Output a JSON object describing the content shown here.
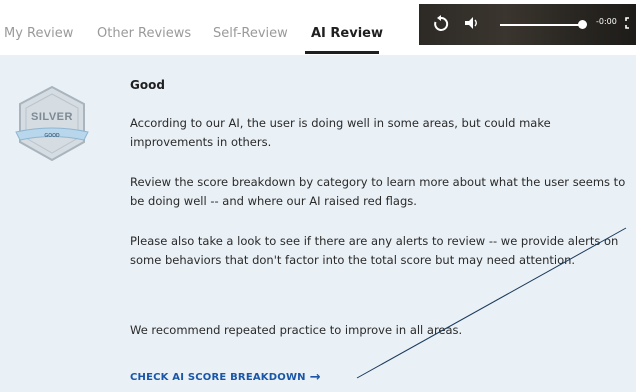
{
  "tabs": [
    {
      "label": "My Review",
      "active": false
    },
    {
      "label": "Other Reviews",
      "active": false
    },
    {
      "label": "Self-Review",
      "active": false
    },
    {
      "label": "AI Review",
      "active": true
    }
  ],
  "player": {
    "time": "-0:00",
    "replay_icon": "replay-icon",
    "volume_icon": "volume-icon",
    "fullscreen_icon": "fullscreen-icon"
  },
  "badge": {
    "tier": "SILVER",
    "ribbon": "GOOD"
  },
  "review": {
    "heading": "Good",
    "paragraphs": [
      "According to our AI, the user is doing well in some areas, but could make improvements in others.",
      "Review the score breakdown by category to learn more about what the user seems to be doing well -- and where our AI raised red flags.",
      "Please also take a look to see if there are any alerts to review -- we provide alerts on some behaviors that don't factor into the total score but may need attention.",
      "We recommend repeated practice to improve in all areas."
    ],
    "cta_label": "CHECK AI SCORE BREAKDOWN"
  },
  "colors": {
    "panel_bg": "#e9f0f6",
    "link": "#1a56a8",
    "badge_silver": "#cfd6dc",
    "badge_ribbon": "#b9d7ec"
  }
}
